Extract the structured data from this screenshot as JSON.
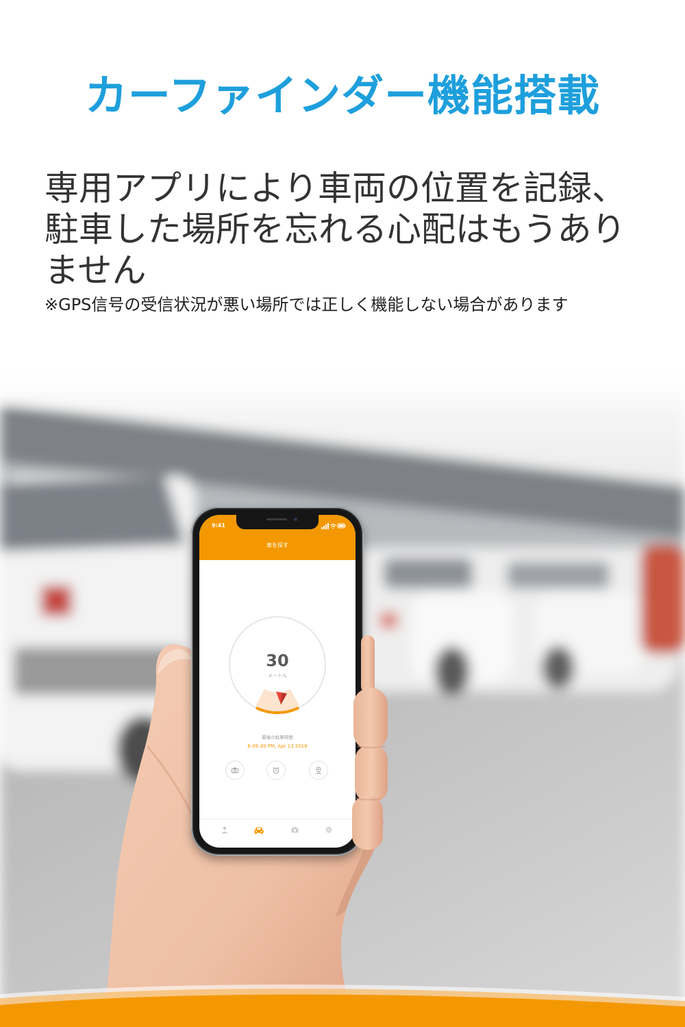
{
  "colors": {
    "title": "#1e9fdc",
    "accent": "#f39800",
    "body_text": "#333333"
  },
  "header": {
    "title": "カーファインダー機能搭載"
  },
  "description": {
    "lines": [
      "専用アプリにより車両の位置を記録、",
      "駐車した場所を忘れる心配はもうあり",
      "ません"
    ],
    "note": "※GPS信号の受信状況が悪い場所では正しく機能しない場合があります"
  },
  "phone": {
    "status_bar": {
      "time": "9:41",
      "icons": [
        "signal-icon",
        "wifi-icon",
        "battery-icon"
      ]
    },
    "app_bar": {
      "title": "車を探す"
    },
    "finder": {
      "distance": "30",
      "unit": "メートル",
      "direction_icon": "direction-arrow-icon"
    },
    "last_parked": {
      "label": "最後の駐車時間",
      "time": "6:09:39 PM, Apr 13 2018"
    },
    "actions": [
      {
        "icon": "camera-icon"
      },
      {
        "icon": "alarm-clock-icon"
      },
      {
        "icon": "location-pin-icon"
      }
    ],
    "tabs": [
      {
        "icon": "person-icon",
        "active": false
      },
      {
        "icon": "car-icon",
        "active": true
      },
      {
        "icon": "photo-icon",
        "active": false
      },
      {
        "icon": "gear-icon",
        "active": false
      }
    ]
  }
}
